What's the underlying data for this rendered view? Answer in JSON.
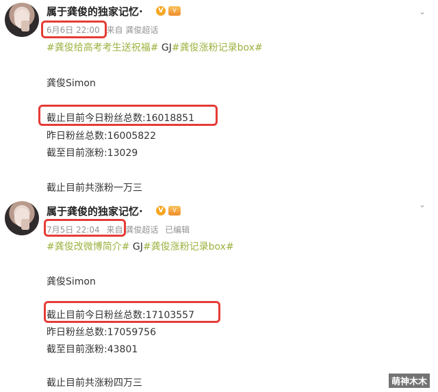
{
  "posts": [
    {
      "username": "属于龚俊的独家记忆·",
      "badge_v": "V",
      "time": "6月6日 22:00",
      "source": "来自 龚俊超话",
      "edited": "",
      "tag1": "#龚俊给高考考生送祝福#",
      "tag_plain": " GJ",
      "tag2": "#龚俊涨粉记录box#",
      "name_line": "龚俊Simon",
      "today_fans": "截止目前今日粉丝总数:16018851",
      "yesterday_fans": "昨日粉丝总数:16005822",
      "gain": "截至目前涨粉:13029",
      "total_gain": "截止目前共涨粉一万三"
    },
    {
      "username": "属于龚俊的独家记忆·",
      "badge_v": "V",
      "time": "7月5日 22:04",
      "source": "来自 龚俊超话",
      "edited": "已编辑",
      "tag1": "#龚俊改微博简介#",
      "tag_plain": " GJ",
      "tag2": "#龚俊涨粉记录box#",
      "name_line": "龚俊Simon",
      "today_fans": "截止目前今日粉丝总数:17103557",
      "yesterday_fans": "昨日粉丝总数:17059756",
      "gain": "截至目前涨粉:43801",
      "total_gain": "截止目前共涨粉四万三"
    }
  ],
  "watermark": "萌神木木",
  "colors": {
    "highlight_box": "#e53b36",
    "topic_link": "#9bb23f",
    "meta_text": "#939393"
  },
  "icons": [
    "avatar",
    "verified-v-icon",
    "vip-badge-icon",
    "chevron-down-icon"
  ]
}
